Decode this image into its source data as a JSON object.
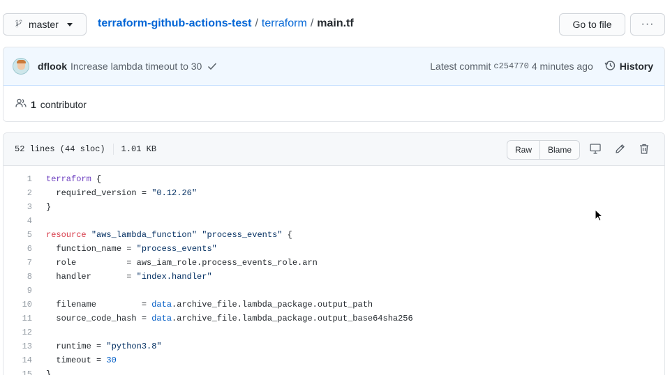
{
  "topbar": {
    "branch_label": "master",
    "breadcrumb": {
      "repo": "terraform-github-actions-test",
      "separator": "/",
      "directory": "terraform",
      "file": "main.tf"
    },
    "go_to_file_label": "Go to file",
    "more_label": "···"
  },
  "commit": {
    "author": "dflook",
    "message": "Increase lambda timeout to 30",
    "latest_commit_label": "Latest commit",
    "sha": "c254770",
    "time_ago": "4 minutes ago",
    "history_label": "History",
    "contributors_count": "1",
    "contributors_label": "contributor"
  },
  "file": {
    "lines_info": "52 lines (44 sloc)",
    "size": "1.01 KB",
    "raw_label": "Raw",
    "blame_label": "Blame",
    "icons": [
      "desktop-icon",
      "pencil-icon",
      "trash-icon"
    ]
  },
  "code": {
    "lines": [
      {
        "n": "1",
        "tokens": [
          [
            "kw",
            "terraform"
          ],
          [
            "id",
            " {"
          ]
        ]
      },
      {
        "n": "2",
        "tokens": [
          [
            "id",
            "  required_version = "
          ],
          [
            "str",
            "\"0.12.26\""
          ]
        ]
      },
      {
        "n": "3",
        "tokens": [
          [
            "id",
            "}"
          ]
        ]
      },
      {
        "n": "4",
        "tokens": []
      },
      {
        "n": "5",
        "tokens": [
          [
            "res",
            "resource"
          ],
          [
            "id",
            " "
          ],
          [
            "str",
            "\"aws_lambda_function\""
          ],
          [
            "id",
            " "
          ],
          [
            "str",
            "\"process_events\""
          ],
          [
            "id",
            " {"
          ]
        ]
      },
      {
        "n": "6",
        "tokens": [
          [
            "id",
            "  function_name = "
          ],
          [
            "str",
            "\"process_events\""
          ]
        ]
      },
      {
        "n": "7",
        "tokens": [
          [
            "id",
            "  role          = aws_iam_role.process_events_role.arn"
          ]
        ]
      },
      {
        "n": "8",
        "tokens": [
          [
            "id",
            "  handler       = "
          ],
          [
            "str",
            "\"index.handler\""
          ]
        ]
      },
      {
        "n": "9",
        "tokens": []
      },
      {
        "n": "10",
        "tokens": [
          [
            "id",
            "  filename         = "
          ],
          [
            "data",
            "data"
          ],
          [
            "id",
            ".archive_file.lambda_package.output_path"
          ]
        ]
      },
      {
        "n": "11",
        "tokens": [
          [
            "id",
            "  source_code_hash = "
          ],
          [
            "data",
            "data"
          ],
          [
            "id",
            ".archive_file.lambda_package.output_base64sha256"
          ]
        ]
      },
      {
        "n": "12",
        "tokens": []
      },
      {
        "n": "13",
        "tokens": [
          [
            "id",
            "  runtime = "
          ],
          [
            "str",
            "\"python3.8\""
          ]
        ]
      },
      {
        "n": "14",
        "tokens": [
          [
            "id",
            "  timeout = "
          ],
          [
            "num",
            "30"
          ]
        ]
      },
      {
        "n": "15",
        "tokens": [
          [
            "id",
            "}"
          ]
        ]
      }
    ]
  },
  "colors": {
    "link": "#0366d6",
    "commit_bg": "#f1f8ff",
    "header_bg": "#f6f8fa"
  }
}
